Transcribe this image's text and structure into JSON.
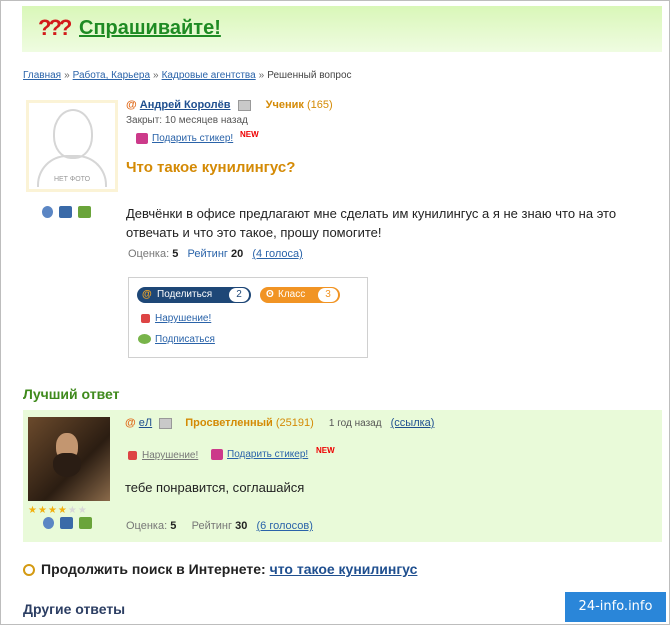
{
  "header": {
    "logo_mark": "???",
    "site_title": "Спрашивайте!"
  },
  "breadcrumb": {
    "items": [
      "Главная",
      "Работа, Карьера",
      "Кадровые агентства"
    ],
    "current": "Решенный вопрос",
    "separator": "»"
  },
  "question": {
    "avatar_label": "НЕТ ФОТО",
    "author": "Андрей Королёв",
    "rank": "Ученик",
    "points": "(165)",
    "closed": "Закрыт: 10 месяцев назад",
    "gift_label": "Подарить стикер!",
    "new_badge": "NEW",
    "title": "Что такое кунилингус?",
    "text": "Девчёнки в офисе предлагают мне сделать им кунилингус а я не знаю что на это отвечать и что это такое, прошу помогите!",
    "score_label": "Оценка:",
    "score": "5",
    "rating_label": "Рейтинг",
    "rating": "20",
    "votes": "(4 голоса)"
  },
  "share": {
    "share_label": "Поделиться",
    "share_count": "2",
    "class_label": "Класс",
    "class_count": "3",
    "report_label": "Нарушение!",
    "subscribe_label": "Подписаться"
  },
  "best_answer": {
    "section_title": "Лучший ответ",
    "author": "еЛ",
    "rank": "Просветленный",
    "points": "(25191)",
    "time": "1 год назад",
    "link_label": "(ссылка)",
    "report_label": "Нарушение!",
    "gift_label": "Подарить стикер!",
    "new_badge": "NEW",
    "text": "тебе понравится, соглашайся",
    "score_label": "Оценка:",
    "score": "5",
    "rating_label": "Рейтинг",
    "rating": "30",
    "votes": "(6 голосов)",
    "stars_filled": 4,
    "stars_total": 6
  },
  "continue_search": {
    "label": "Продолжить поиск в Интернете:",
    "query": "что такое кунилингус"
  },
  "other_answers": {
    "title": "Другие ответы"
  },
  "watermark": "24-info.info",
  "colors": {
    "header_green": "#d9f7b8",
    "best_bg": "#e9fad9",
    "rank_orange": "#d48a05",
    "link_blue": "#2a63a9"
  }
}
